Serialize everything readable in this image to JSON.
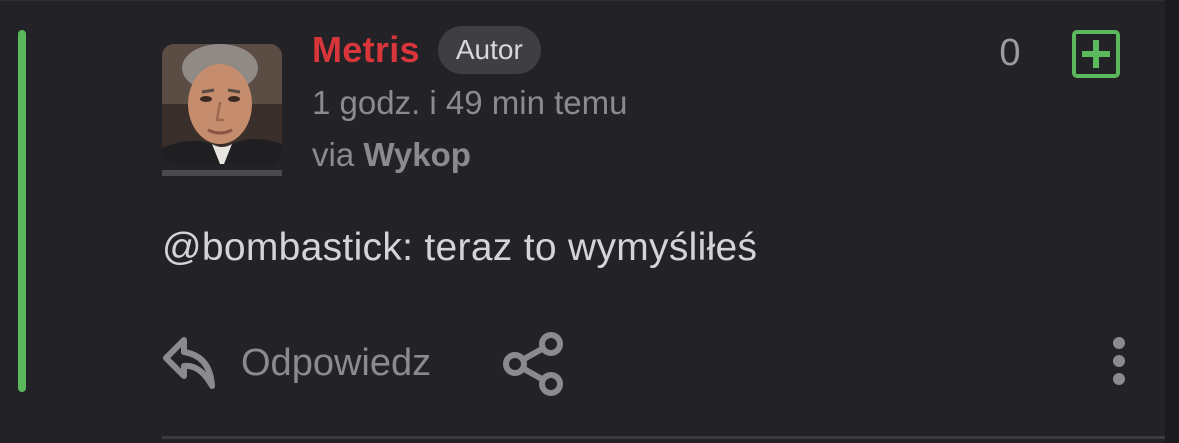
{
  "comment": {
    "author": {
      "username": "Metris",
      "badge": "Autor",
      "avatar_icon": "avatar-photo"
    },
    "timestamp": "1 godz. i 49 min temu",
    "via_prefix": "via",
    "via_app": "Wykop",
    "votes": "0",
    "body": "@bombastick: teraz to wymyśliłeś",
    "actions": {
      "reply_label": "Odpowiedz",
      "reply_icon": "reply-icon",
      "share_icon": "share-icon",
      "more_icon": "more-vertical-icon",
      "plus_icon": "plus-vote-icon"
    }
  },
  "colors": {
    "background": "#232327",
    "username": "#d9363b",
    "accent_green": "#5cb85c",
    "muted_text": "#8a8a90",
    "body_text": "#d4d4d8",
    "badge_bg": "#3e3e43"
  }
}
